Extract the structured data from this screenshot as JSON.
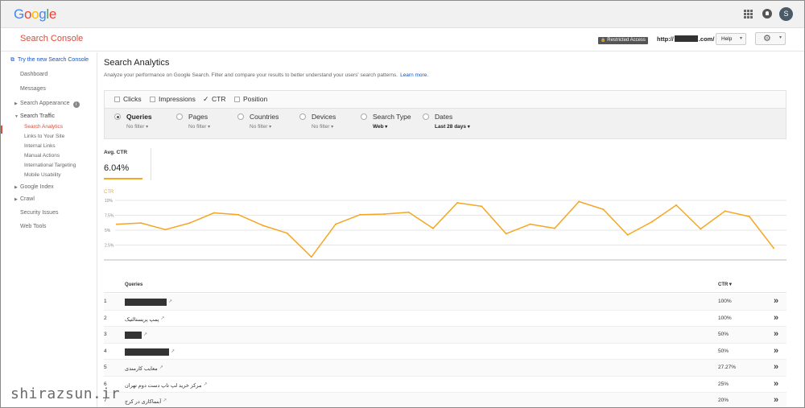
{
  "header": {
    "logo_letters": [
      {
        "ch": "G",
        "color": "#4285f4"
      },
      {
        "ch": "o",
        "color": "#ea4335"
      },
      {
        "ch": "o",
        "color": "#fbbc05"
      },
      {
        "ch": "g",
        "color": "#4285f4"
      },
      {
        "ch": "l",
        "color": "#34a853"
      },
      {
        "ch": "e",
        "color": "#ea4335"
      }
    ],
    "avatar_initial": "S"
  },
  "subbar": {
    "product_title": "Search Console",
    "restricted_label": "Restricted Access",
    "site_prefix": "http://",
    "site_suffix": ".com/",
    "help_label": "Help"
  },
  "sidebar": {
    "new_console_link": "Try the new Search Console",
    "dashboard": "Dashboard",
    "messages": "Messages",
    "search_appearance": "Search Appearance",
    "search_traffic": "Search Traffic",
    "sub_items": [
      "Search Analytics",
      "Links to Your Site",
      "Internal Links",
      "Manual Actions",
      "International Targeting",
      "Mobile Usability"
    ],
    "google_index": "Google Index",
    "crawl": "Crawl",
    "security_issues": "Security Issues",
    "web_tools": "Web Tools",
    "accent_color": "#dd4b39"
  },
  "main": {
    "title": "Search Analytics",
    "description": "Analyze your performance on Google Search. Filter and compare your results to better understand your users' search patterns.",
    "learn_more": "Learn more.",
    "metrics": [
      {
        "label": "Clicks",
        "checked": false
      },
      {
        "label": "Impressions",
        "checked": false
      },
      {
        "label": "CTR",
        "checked": true
      },
      {
        "label": "Position",
        "checked": false
      }
    ],
    "dimensions": [
      {
        "label": "Queries",
        "filter": "No filter",
        "selected": true
      },
      {
        "label": "Pages",
        "filter": "No filter",
        "selected": false
      },
      {
        "label": "Countries",
        "filter": "No filter",
        "selected": false
      },
      {
        "label": "Devices",
        "filter": "No filter",
        "selected": false
      },
      {
        "label": "Search Type",
        "filter": "Web",
        "selected": false
      },
      {
        "label": "Dates",
        "filter": "Last 28 days",
        "selected": false
      }
    ],
    "avg_label": "Avg. CTR",
    "avg_value": "6.04%"
  },
  "chart_data": {
    "type": "line",
    "series": [
      {
        "name": "CTR",
        "values": [
          6.0,
          6.2,
          5.1,
          6.2,
          7.9,
          7.6,
          5.8,
          4.5,
          0.5,
          6.0,
          7.6,
          7.7,
          8.0,
          5.3,
          9.6,
          9.0,
          4.4,
          6.0,
          5.3,
          9.8,
          8.5,
          4.2,
          6.4,
          9.2,
          5.2,
          8.2,
          7.3,
          2.0
        ]
      }
    ],
    "ylim": [
      0,
      10
    ],
    "y_ticks": [
      {
        "value": 2.5,
        "label": "2.5%"
      },
      {
        "value": 5,
        "label": "5%"
      },
      {
        "value": 7.5,
        "label": "7.5%"
      },
      {
        "value": 10,
        "label": "10%"
      }
    ],
    "line_color": "#f5a623",
    "grid": true
  },
  "table": {
    "col_query": "Queries",
    "col_ctr": "CTR",
    "sort_indicator": "▼",
    "go_icon": "»",
    "ext_icon": "↗",
    "rows": [
      {
        "num": "1",
        "query": "",
        "mask_width": 52,
        "ctr": "100%"
      },
      {
        "num": "2",
        "query": "پمپ پریستالتیک",
        "mask_width": 0,
        "ctr": "100%"
      },
      {
        "num": "3",
        "query": "",
        "mask_width": 21,
        "ctr": "50%"
      },
      {
        "num": "4",
        "query": "",
        "mask_width": 55,
        "ctr": "50%"
      },
      {
        "num": "5",
        "query": "معایب کارمندی",
        "mask_width": 0,
        "ctr": "27.27%"
      },
      {
        "num": "6",
        "query": "مرکز خرید لپ تاپ دست دوم تهران",
        "mask_width": 0,
        "ctr": "25%"
      },
      {
        "num": "7",
        "query": "آبنماکاری در کرج",
        "mask_width": 0,
        "ctr": "20%"
      }
    ]
  },
  "watermark": "shirazsun.ir"
}
